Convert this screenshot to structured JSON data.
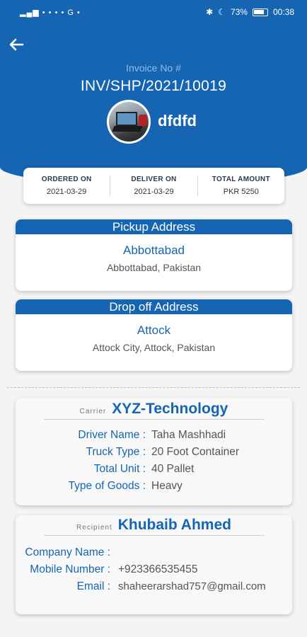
{
  "status_bar": {
    "signal_icons": "▂▄▆ • • • • G •",
    "battery": "73%",
    "time": "00:38"
  },
  "invoice": {
    "label": "Invoice No #",
    "number": "INV/SHP/2021/10019",
    "shop_name": "dfdfd"
  },
  "summary": [
    {
      "label": "ORDERED ON",
      "value": "2021-03-29"
    },
    {
      "label": "DELIVER ON",
      "value": "2021-03-29"
    },
    {
      "label": "TOTAL AMOUNT",
      "value": "PKR 5250"
    }
  ],
  "pickup": {
    "title": "Pickup Address",
    "city": "Abbottabad",
    "address": "Abbottabad, Pakistan"
  },
  "dropoff": {
    "title": "Drop off Address",
    "city": "Attock",
    "address": "Attock City, Attock, Pakistan"
  },
  "carrier": {
    "label": "Carrier",
    "name": "XYZ-Technology",
    "rows": [
      {
        "key": "Driver Name :",
        "value": "Taha Mashhadi"
      },
      {
        "key": "Truck Type :",
        "value": "20 Foot Container"
      },
      {
        "key": "Total Unit :",
        "value": "40 Pallet"
      },
      {
        "key": "Type of Goods :",
        "value": "Heavy"
      }
    ]
  },
  "recipient": {
    "label": "Recipient",
    "name": "Khubaib Ahmed",
    "rows": [
      {
        "key": "Company Name :",
        "value": ""
      },
      {
        "key": "Mobile Number :",
        "value": "+923366535455"
      },
      {
        "key": "Email :",
        "value": "shaheerarshad757@gmail.com"
      }
    ]
  },
  "colors": {
    "primary": "#1565b3",
    "background": "#f4f4f4"
  }
}
